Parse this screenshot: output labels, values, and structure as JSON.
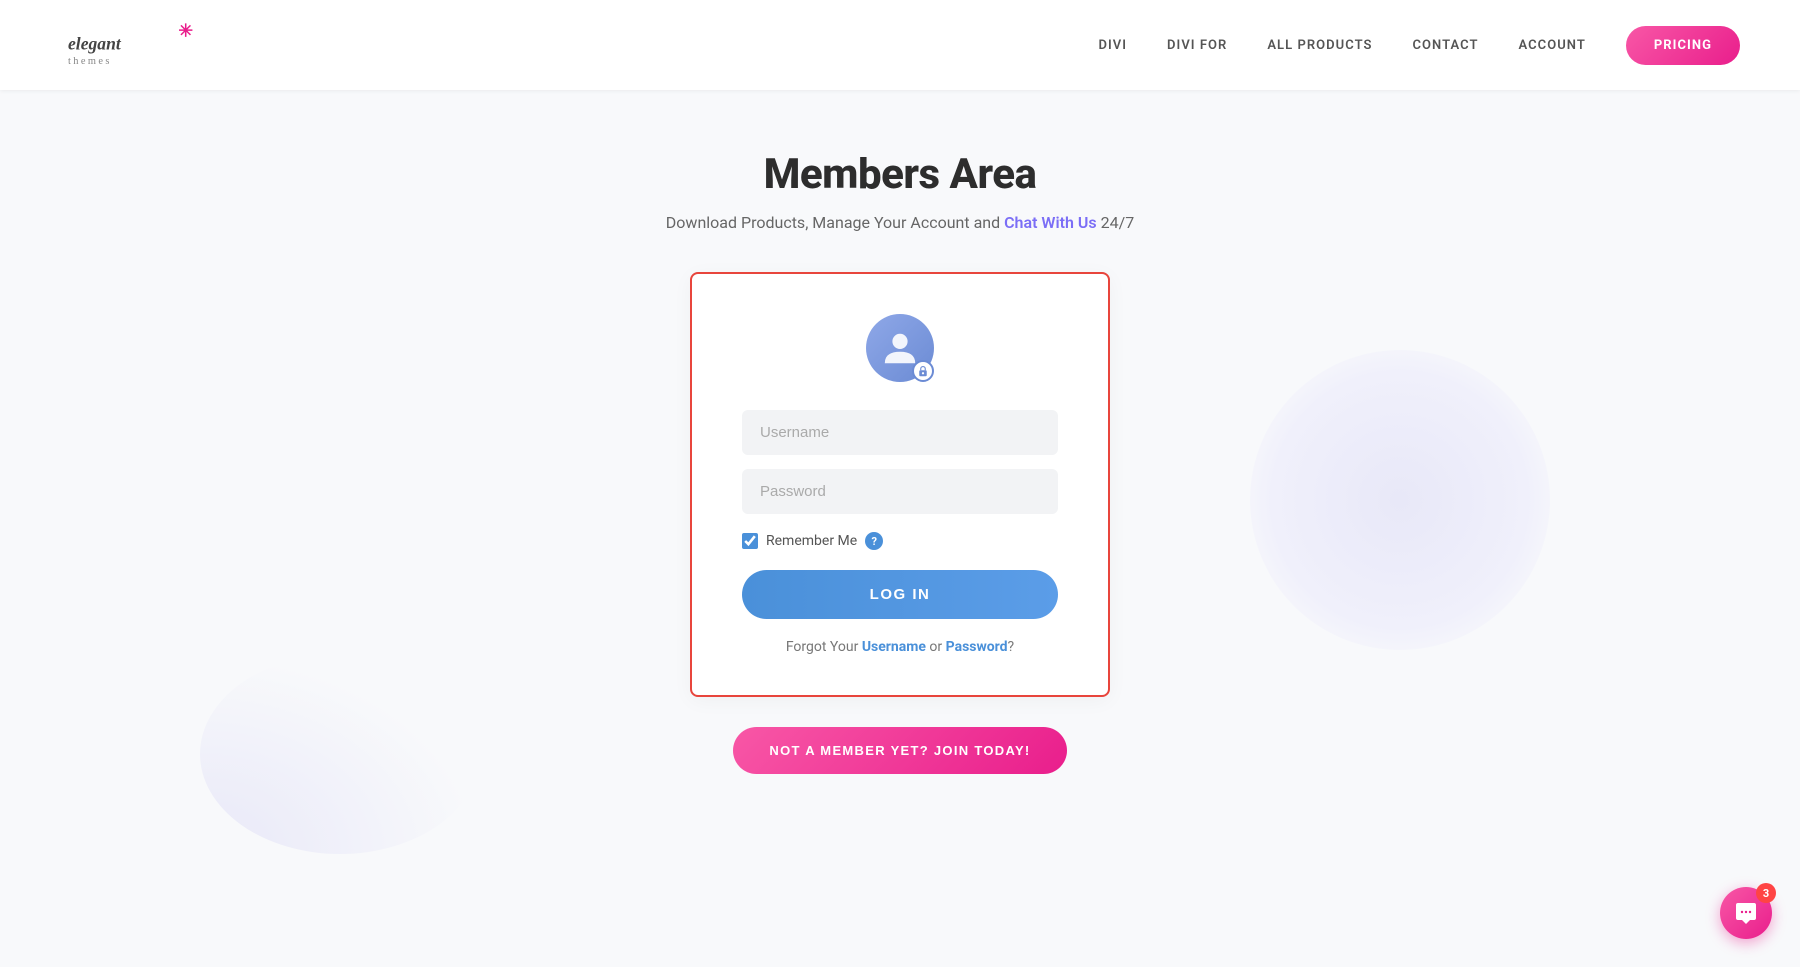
{
  "header": {
    "logo_alt": "Elegant Themes",
    "nav": {
      "items": [
        {
          "label": "DIVI",
          "href": "#"
        },
        {
          "label": "DIVI FOR",
          "href": "#"
        },
        {
          "label": "ALL PRODUCTS",
          "href": "#"
        },
        {
          "label": "CONTACT",
          "href": "#"
        },
        {
          "label": "ACCOUNT",
          "href": "#"
        }
      ],
      "pricing_label": "PRICING"
    }
  },
  "main": {
    "title": "Members Area",
    "subtitle_prefix": "Download Products, Manage Your Account and ",
    "chat_link_label": "Chat With Us",
    "subtitle_suffix": " 24/7"
  },
  "login_card": {
    "username_placeholder": "Username",
    "password_placeholder": "Password",
    "remember_me_label": "Remember Me",
    "login_button_label": "LOG IN",
    "forgot_prefix": "Forgot Your ",
    "forgot_username_label": "Username",
    "forgot_or": " or ",
    "forgot_password_label": "Password",
    "forgot_suffix": "?"
  },
  "join_button_label": "NOT A MEMBER YET? JOIN TODAY!",
  "chat_widget": {
    "badge_count": "3"
  },
  "colors": {
    "accent_pink": "#e91e8c",
    "accent_blue": "#4a90d9",
    "accent_purple": "#7b6ef6",
    "border_red": "#e8453c"
  }
}
